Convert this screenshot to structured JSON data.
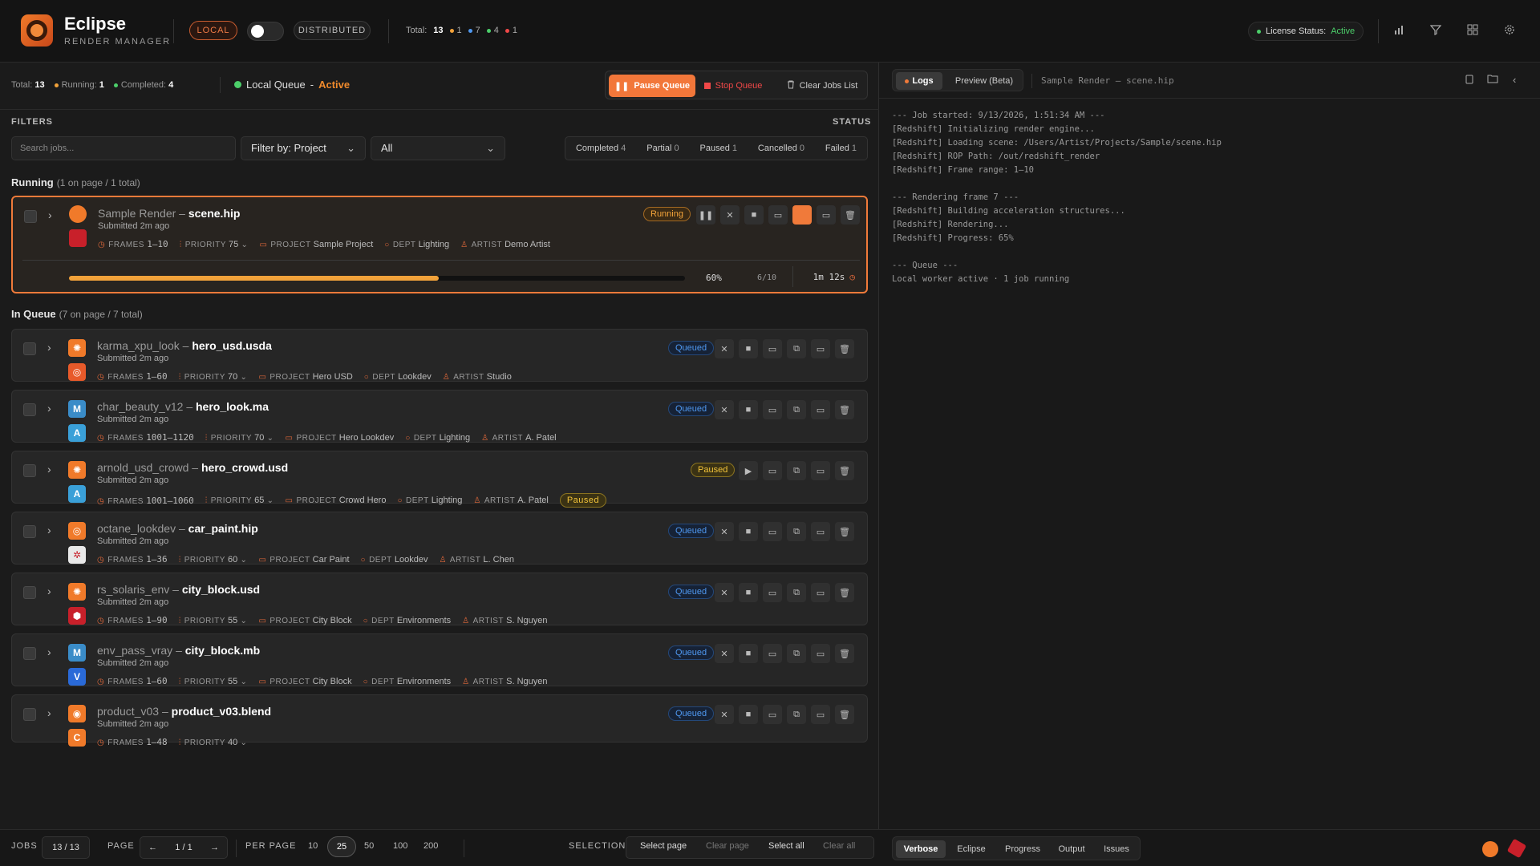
{
  "app": {
    "name": "Eclipse",
    "subtitle": "RENDER MANAGER"
  },
  "mode": {
    "local_label": "LOCAL",
    "distributed_label": "DISTRIBUTED",
    "toggle_on": false
  },
  "topbar_stats": {
    "total_label": "Total:",
    "total": "13",
    "orange": "1",
    "blue": "7",
    "green": "4",
    "red": "1"
  },
  "license": {
    "label": "License Status:",
    "value": "Active"
  },
  "summary": {
    "total_label": "Total:",
    "total": "13",
    "running_label": "Running:",
    "running": "1",
    "completed_label": "Completed:",
    "completed": "4",
    "queue_label": "Local Queue",
    "queue_sep": "-",
    "queue_state": "Active"
  },
  "queue_controls": {
    "pause": "Pause Queue",
    "stop": "Stop Queue",
    "clear": "Clear Jobs List"
  },
  "filters": {
    "label": "FILTERS",
    "status_label": "STATUS",
    "search_placeholder": "Search jobs...",
    "filter_by": "Filter by: Project",
    "filter_value": "All",
    "status": [
      {
        "label": "Completed",
        "count": "4"
      },
      {
        "label": "Partial",
        "count": "0"
      },
      {
        "label": "Paused",
        "count": "1"
      },
      {
        "label": "Cancelled",
        "count": "0"
      },
      {
        "label": "Failed",
        "count": "1"
      }
    ]
  },
  "sections": {
    "running": {
      "title": "Running",
      "sub": "(1 on page / 1 total)"
    },
    "queue": {
      "title": "In Queue",
      "sub": "(7 on page / 7 total)"
    }
  },
  "meta_keys": {
    "frames": "FRAMES",
    "priority": "PRIORITY",
    "project": "PROJECT",
    "dept": "DEPT",
    "artist": "ARTIST"
  },
  "running_job": {
    "name": "Sample Render",
    "sep": "–",
    "file": "scene.hip",
    "submitted": "Submitted 2m ago",
    "frames": "1–10",
    "priority": "75",
    "project": "Sample Project",
    "dept": "Lighting",
    "artist": "Demo Artist",
    "status": "Running",
    "progress": 0.6,
    "progress_label": "60%",
    "frames_done": "6/10",
    "eta": "1m 12s"
  },
  "jobs": [
    {
      "name": "karma_xpu_look",
      "sep": "–",
      "file": "hero_usd.usda",
      "submitted": "Submitted 2m ago",
      "frames": "1–60",
      "priority": "70",
      "project": "Hero USD",
      "dept": "Lookdev",
      "artist": "Studio",
      "status": "Queued"
    },
    {
      "name": "char_beauty_v12",
      "sep": "–",
      "file": "hero_look.ma",
      "submitted": "Submitted 2m ago",
      "frames": "1001–1120",
      "priority": "70",
      "project": "Hero Lookdev",
      "dept": "Lighting",
      "artist": "A. Patel",
      "status": "Queued"
    },
    {
      "name": "arnold_usd_crowd",
      "sep": "–",
      "file": "hero_crowd.usd",
      "submitted": "Submitted 2m ago",
      "frames": "1001–1060",
      "priority": "65",
      "project": "Crowd Hero",
      "dept": "Lighting",
      "artist": "A. Patel",
      "status": "Paused",
      "tag": "Paused"
    },
    {
      "name": "octane_lookdev",
      "sep": "–",
      "file": "car_paint.hip",
      "submitted": "Submitted 2m ago",
      "frames": "1–36",
      "priority": "60",
      "project": "Car Paint",
      "dept": "Lookdev",
      "artist": "L. Chen",
      "status": "Queued"
    },
    {
      "name": "rs_solaris_env",
      "sep": "–",
      "file": "city_block.usd",
      "submitted": "Submitted 2m ago",
      "frames": "1–90",
      "priority": "55",
      "project": "City Block",
      "dept": "Environments",
      "artist": "S. Nguyen",
      "status": "Queued"
    },
    {
      "name": "env_pass_vray",
      "sep": "–",
      "file": "city_block.mb",
      "submitted": "Submitted 2m ago",
      "frames": "1–60",
      "priority": "55",
      "project": "City Block",
      "dept": "Environments",
      "artist": "S. Nguyen",
      "status": "Queued"
    },
    {
      "name": "product_v03",
      "sep": "–",
      "file": "product_v03.blend",
      "submitted": "Submitted 2m ago",
      "frames": "1–48",
      "priority": "40",
      "status": "Queued"
    }
  ],
  "bottom": {
    "jobs_label": "JOBS",
    "jobs_value": "13 / 13",
    "page_label": "PAGE",
    "page_value": "1 / 1",
    "per_page_label": "PER PAGE",
    "per_page": [
      "10",
      "25",
      "50",
      "100",
      "200"
    ],
    "per_page_selected": "25",
    "selection_label": "SELECTION",
    "select_page": "Select page",
    "clear_page": "Clear page",
    "select_all": "Select all",
    "clear_all": "Clear all"
  },
  "right": {
    "tab_logs": "Logs",
    "tab_preview": "Preview (Beta)",
    "log_title": "Sample Render – scene.hip",
    "log_lines": [
      "--- Job started: 9/13/2026, 1:51:34 AM ---",
      "[Redshift] Initializing render engine...",
      "[Redshift] Loading scene: /Users/Artist/Projects/Sample/scene.hip",
      "[Redshift] ROP Path: /out/redshift_render",
      "[Redshift] Frame range: 1–10",
      "",
      "--- Rendering frame 7 ---",
      "[Redshift] Building acceleration structures...",
      "[Redshift] Rendering...",
      "[Redshift] Progress: 65%",
      "",
      "--- Queue ---",
      "Local worker active · 1 job running"
    ],
    "bottom_tabs": [
      "Verbose",
      "Eclipse",
      "Progress",
      "Output",
      "Issues"
    ]
  }
}
